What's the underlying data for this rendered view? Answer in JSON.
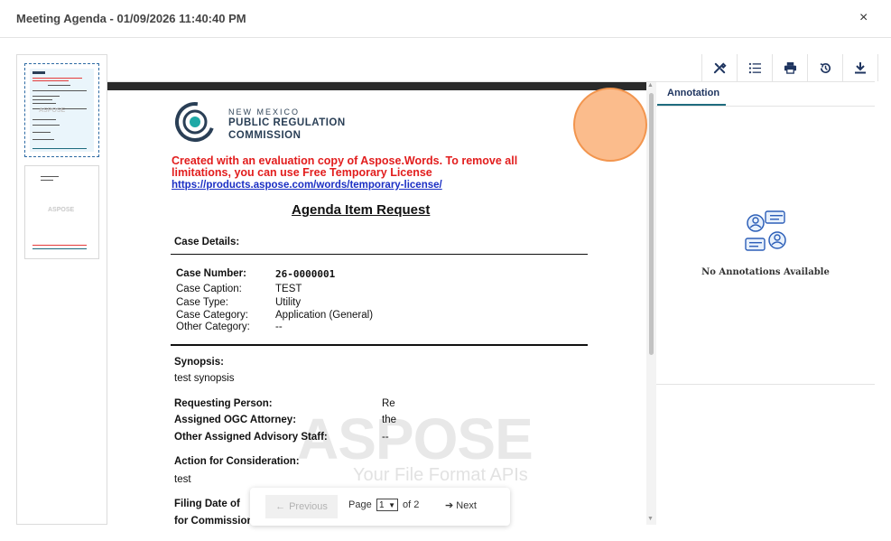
{
  "dialog": {
    "title": "Meeting Agenda - 01/09/2026 11:40:40 PM",
    "close_glyph": "×"
  },
  "thumbnails": {
    "pages": [
      {
        "label": "page-1-thumbnail",
        "watermark": "ASPOSE"
      },
      {
        "label": "page-2-thumbnail",
        "watermark": "ASPOSE"
      }
    ]
  },
  "toolbar": {
    "tools": [
      "tools-icon",
      "list-icon",
      "print-icon",
      "history-icon",
      "download-icon"
    ]
  },
  "document": {
    "org_line1": "NEW MEXICO",
    "org_line2": "PUBLIC REGULATION",
    "org_line3": "COMMISSION",
    "eval_notice": "Created with an evaluation copy of Aspose.Words. To remove all limitations, you can use Free Temporary License",
    "eval_link": "https://products.aspose.com/words/temporary-license/",
    "title": "Agenda Item Request",
    "case_details_heading": "Case Details:",
    "case_number_label": "Case Number:",
    "case_number_value": "26-0000001",
    "case_caption_label": "Case Caption:",
    "case_caption_value": "TEST",
    "case_type_label": "Case Type:",
    "case_type_value": "Utility",
    "case_category_label": "Case Category:",
    "case_category_value": "Application (General)",
    "other_category_label": "Other Category:",
    "other_category_value": "--",
    "synopsis_label": "Synopsis:",
    "synopsis_value": "test synopsis",
    "requesting_person_label": "Requesting Person:",
    "requesting_person_value": "Re",
    "assigned_attorney_label": "Assigned OGC Attorney:",
    "assigned_attorney_value": "the",
    "other_staff_label": "Other Assigned Advisory Staff:",
    "other_staff_value": "--",
    "action_label": "Action for Consideration:",
    "action_value": "test",
    "filing_date_label_1": "Filing Date of",
    "filing_date_label_2": "for Commission Action",
    "watermark_main": "ASPOSE",
    "watermark_sub": "Your File Format APIs"
  },
  "pager": {
    "prev_label": "Previous",
    "page_label": "Page",
    "current_page": "1",
    "of_label": "of 2",
    "next_label": "Next"
  },
  "annotations": {
    "tab_label": "Annotation",
    "empty_text": "No Annotations Available"
  },
  "colors": {
    "accent": "#1f3560",
    "tab_underline": "#1f6c7e",
    "eval_red": "#e21d1d",
    "link_blue": "#1b2fc4",
    "cursor_orange": "#fbbc8c"
  }
}
